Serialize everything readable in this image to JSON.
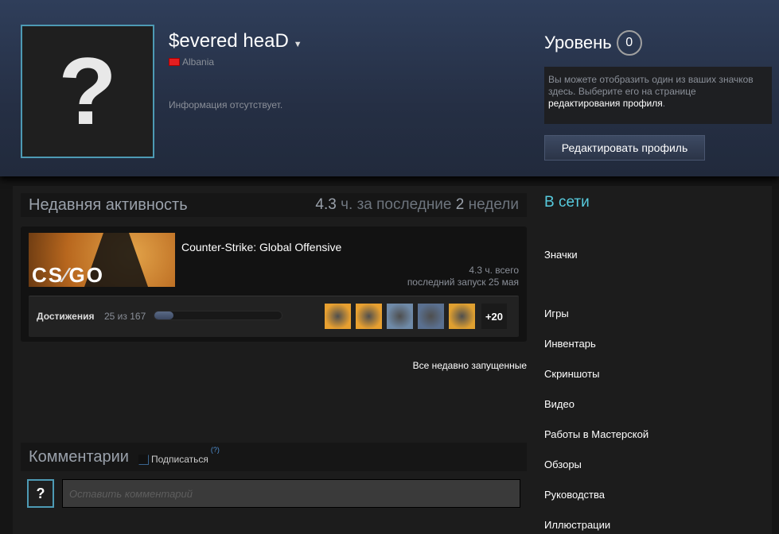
{
  "profile": {
    "name": "$evered heaD",
    "country": "Albania",
    "summary": "Информация отсутствует.",
    "avatar_glyph": "?"
  },
  "level": {
    "label": "Уровень",
    "value": "0"
  },
  "badge_box": {
    "text_before": "Вы можете отобразить один из ваших значков здесь. Выберите его на странице ",
    "link": "редактирования профиля",
    "text_after": "."
  },
  "edit_button": "Редактировать профиль",
  "recent": {
    "title": "Недавняя активность",
    "hours": "4.3",
    "hours_mid": " ч. за последние ",
    "weeks": "2",
    "weeks_suffix": " недели"
  },
  "game": {
    "name": "Counter-Strike: Global Offensive",
    "logo": "CS GO",
    "total": "4.3 ч. всего",
    "last_played": "последний запуск 25 мая",
    "achievements_label": "Достижения",
    "achievements_count": "25 из 167",
    "achievements_progress": 0.15,
    "more": "+20",
    "icon_colors": [
      "#e8a030",
      "#e8a030",
      "#6f8aa8",
      "#5a7090",
      "#e0a030"
    ]
  },
  "all_recent": "Все недавно запущенные",
  "comments": {
    "title": "Комментарии",
    "subscribe": "Подписаться",
    "help": "(?)",
    "placeholder": "Оставить комментарий",
    "avatar_glyph": "?"
  },
  "right": {
    "status": "В сети",
    "links": [
      "Значки",
      "Игры",
      "Инвентарь",
      "Скриншоты",
      "Видео",
      "Работы в Мастерской",
      "Обзоры",
      "Руководства",
      "Иллюстрации"
    ]
  },
  "colors": {
    "online": "#57cbde",
    "avatar_border": "#4d9ab4"
  }
}
